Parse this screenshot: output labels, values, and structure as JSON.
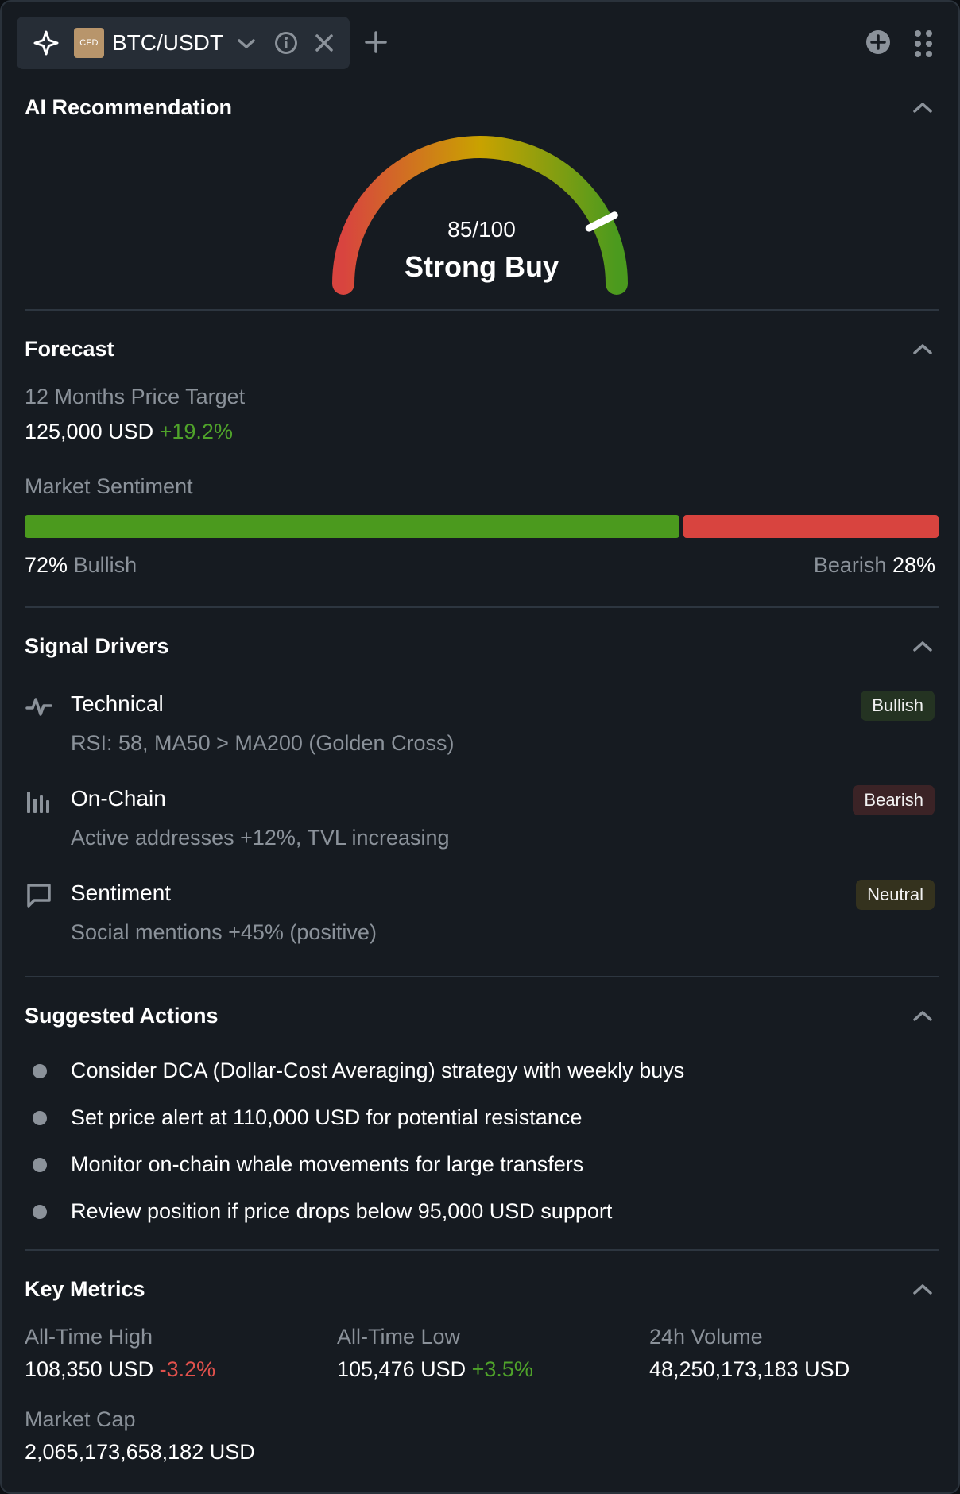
{
  "tab": {
    "badge": "CFD",
    "pair": "BTC/USDT"
  },
  "ai_recommendation": {
    "title": "AI Recommendation",
    "score_text": "85/100",
    "score": 85,
    "score_max": 100,
    "label": "Strong Buy",
    "colors": {
      "low": "#d8443f",
      "mid": "#c9a200",
      "high": "#4b9a1e"
    }
  },
  "forecast": {
    "title": "Forecast",
    "target_label": "12 Months Price Target",
    "target_value": "125,000 USD",
    "target_change": "+19.2%",
    "sentiment_label": "Market Sentiment",
    "bullish_pct": "72%",
    "bullish_label": "Bullish",
    "bearish_label": "Bearish",
    "bearish_pct": "28%",
    "bullish_fraction": 0.72,
    "colors": {
      "bull": "#4b9a1e",
      "bear": "#d8443f"
    }
  },
  "signal_drivers": {
    "title": "Signal Drivers",
    "items": [
      {
        "icon": "pulse-icon",
        "name": "Technical",
        "detail": "RSI: 58, MA50 > MA200 (Golden Cross)",
        "badge": "Bullish"
      },
      {
        "icon": "bar-chart-icon",
        "name": "On-Chain",
        "detail": "Active addresses +12%, TVL increasing",
        "badge": "Bearish"
      },
      {
        "icon": "chat-bubble-icon",
        "name": "Sentiment",
        "detail": "Social mentions +45% (positive)",
        "badge": "Neutral"
      }
    ]
  },
  "suggested_actions": {
    "title": "Suggested Actions",
    "items": [
      "Consider DCA (Dollar-Cost Averaging) strategy with weekly buys",
      "Set price alert at 110,000 USD for potential resistance",
      "Monitor on-chain whale movements for large transfers",
      "Review position if price drops below 95,000 USD support"
    ]
  },
  "key_metrics": {
    "title": "Key Metrics",
    "ath_label": "All-Time High",
    "ath_value": "108,350 USD",
    "ath_change": "-3.2%",
    "atl_label": "All-Time Low",
    "atl_value": "105,476 USD",
    "atl_change": "+3.5%",
    "volume_label": "24h Volume",
    "volume_value": "48,250,173,183 USD",
    "mcap_label": "Market Cap",
    "mcap_value": "2,065,173,658,182 USD"
  }
}
